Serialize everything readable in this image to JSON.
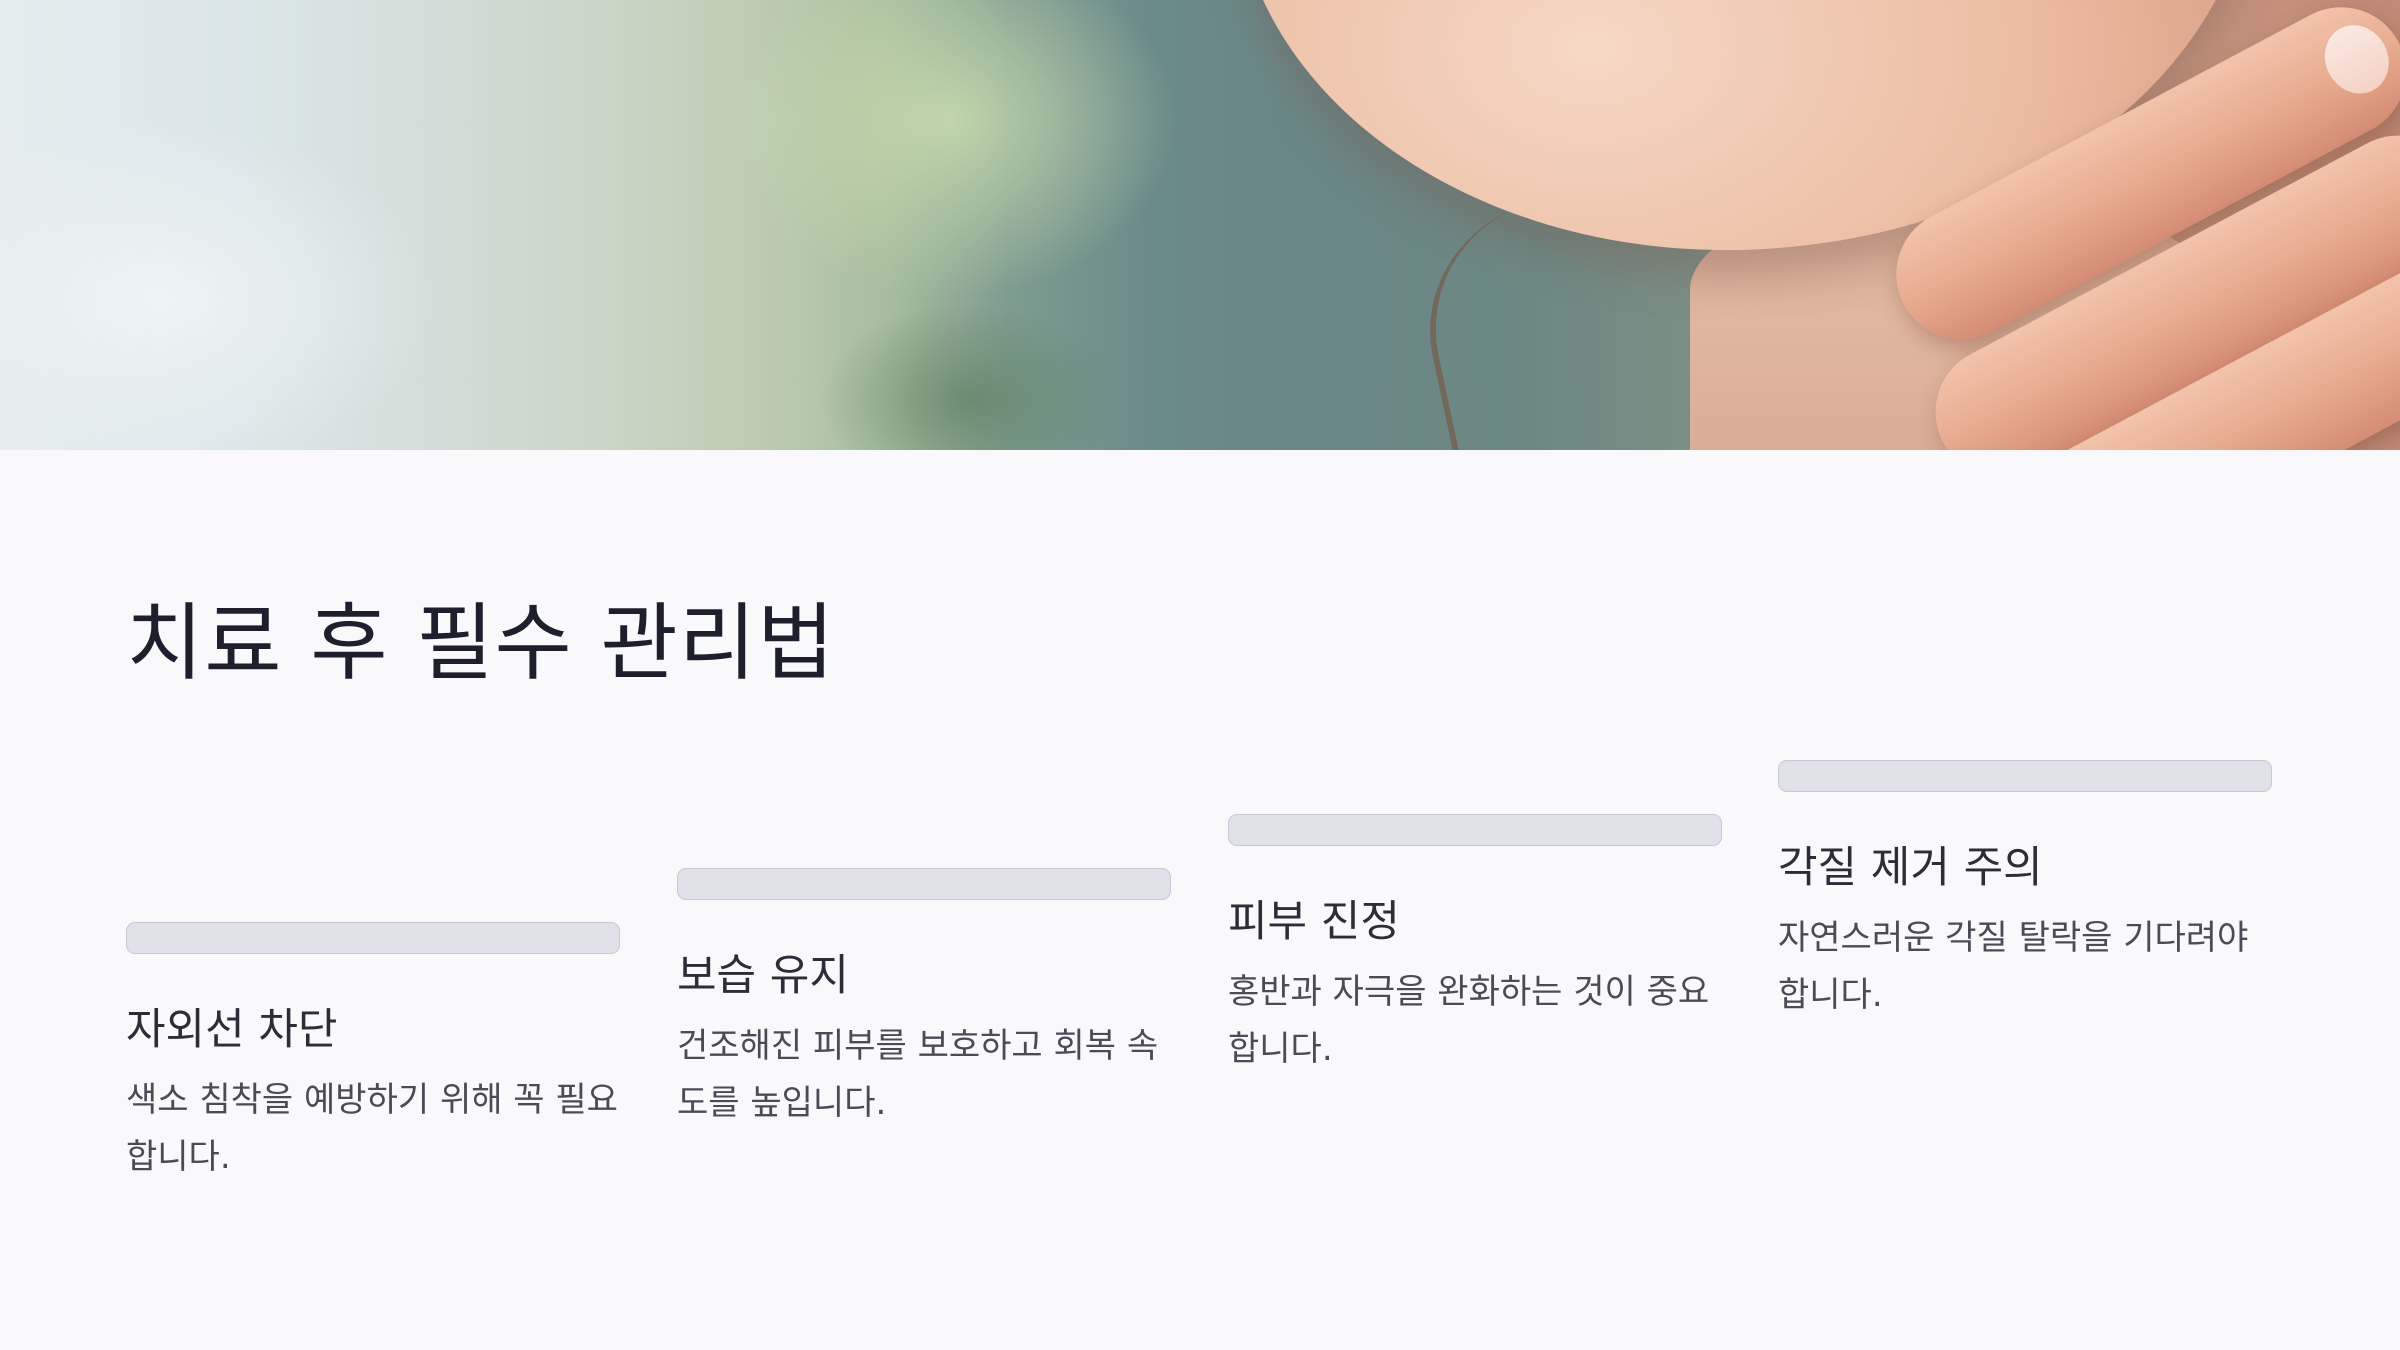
{
  "slide": {
    "title": "치료 후 필수 관리법",
    "cards": [
      {
        "title": "자외선 차단",
        "description": "색소 침착을 예방하기 위해 꼭 필요합니다."
      },
      {
        "title": "보습 유지",
        "description": "건조해진 피부를 보호하고 회복 속도를 높입니다."
      },
      {
        "title": "피부 진정",
        "description": "홍반과 자극을 완화하는 것이 중요합니다."
      },
      {
        "title": "각질 제거 주의",
        "description": "자연스러운 각질 탈락을 기다려야 합니다."
      }
    ]
  },
  "colors": {
    "background": "#f9f9fc",
    "title": "#1d1f2c",
    "card_title": "#2c2d37",
    "card_text": "#4a4b55",
    "bar_fill": "#e1e1e9",
    "bar_border": "#c8c8d2"
  },
  "hero_image": {
    "depicts": "close-up photo-icon of a woman's chin and neck with a hand touching the jaw"
  }
}
